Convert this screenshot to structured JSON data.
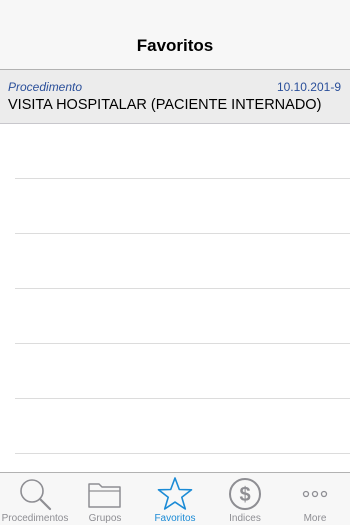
{
  "navbar": {
    "title": "Favoritos"
  },
  "favorites": [
    {
      "subtitle": "Procedimento",
      "code": "10.10.201-9",
      "title": "VISITA HOSPITALAR (PACIENTE INTERNADO)"
    }
  ],
  "tabbar": {
    "items": [
      {
        "label": "Procedimentos",
        "icon": "search-icon",
        "active": false
      },
      {
        "label": "Grupos",
        "icon": "folder-icon",
        "active": false
      },
      {
        "label": "Favoritos",
        "icon": "star-icon",
        "active": true
      },
      {
        "label": "Indices",
        "icon": "dollar-icon",
        "active": false
      },
      {
        "label": "More",
        "icon": "more-icon",
        "active": false
      }
    ]
  },
  "colors": {
    "accent": "#1b8bd6",
    "inactive": "#8e8e93",
    "subtitle": "#2a4f9a"
  }
}
